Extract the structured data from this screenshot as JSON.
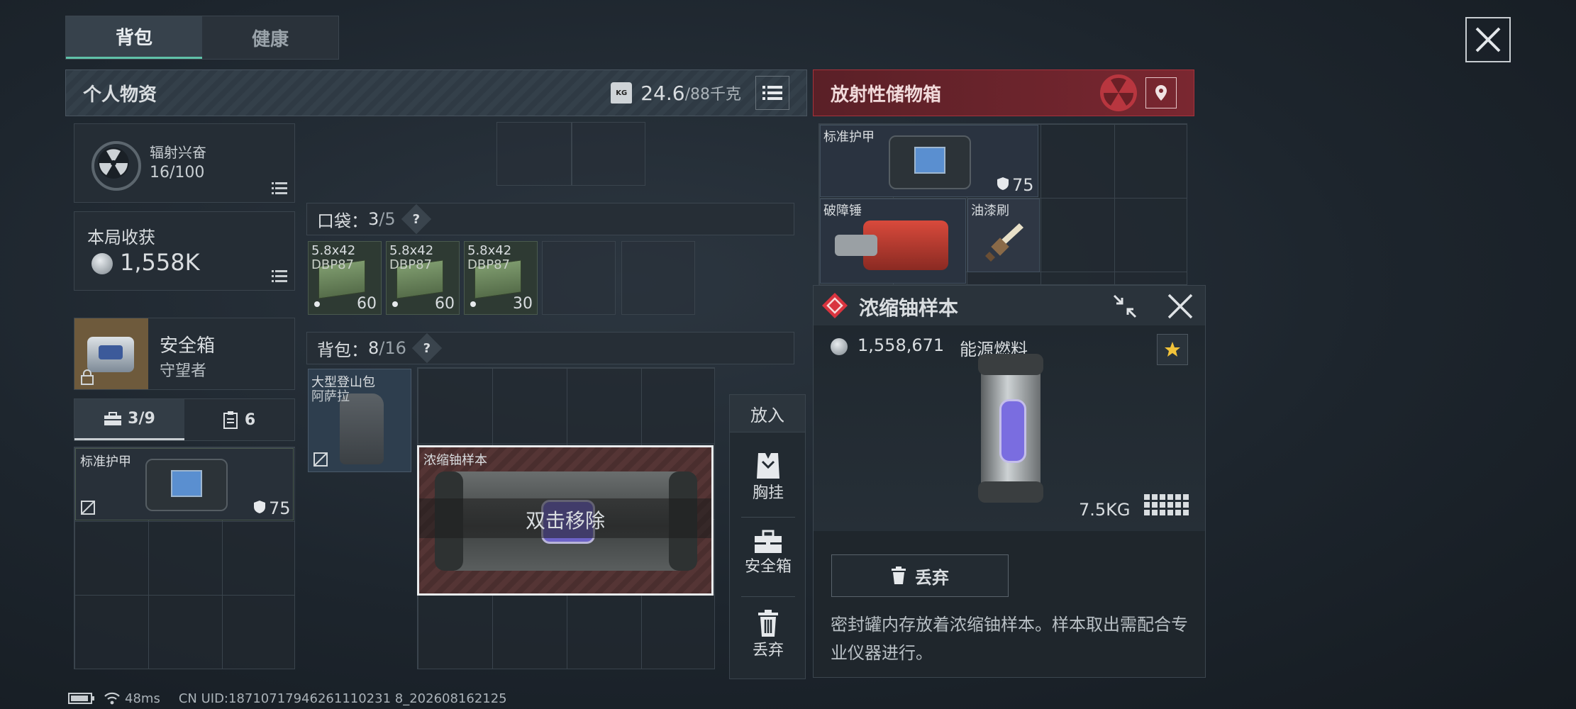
{
  "tabs": [
    "背包",
    "健康"
  ],
  "personal": {
    "title": "个人物资",
    "weight_current": "24.6",
    "weight_max": "/88千克",
    "kg_badge": "KG"
  },
  "radiation": {
    "label": "辐射兴奋",
    "value": "16/100",
    "level": 0.16
  },
  "income": {
    "label": "本局收获",
    "value": "1,558K"
  },
  "safe_box": {
    "name": "安全箱",
    "sub": "守望者"
  },
  "counters": {
    "tools": "3/9",
    "docs": "6"
  },
  "left_item": {
    "name": "标准护甲",
    "durability": "75"
  },
  "pocket": {
    "label": "口袋：",
    "used": "3",
    "total": "/5",
    "help": "?"
  },
  "ammo": [
    {
      "line1": "5.8x42",
      "line2": "DBP87",
      "count": "60"
    },
    {
      "line1": "5.8x42",
      "line2": "DBP87",
      "count": "60"
    },
    {
      "line1": "5.8x42",
      "line2": "DBP87",
      "count": "30"
    }
  ],
  "backpack": {
    "label": "背包：",
    "used": "8",
    "total": "/16",
    "help": "?"
  },
  "bag_item": {
    "line1": "大型登山包",
    "line2": "阿萨拉"
  },
  "uranium_slot": {
    "name": "浓缩铀样本",
    "action": "双击移除"
  },
  "drop_actions": {
    "title": "放入",
    "chest": "胸挂",
    "safe": "安全箱",
    "discard": "丢弃"
  },
  "radio_box": {
    "title": "放射性储物箱",
    "items": [
      {
        "name": "标准护甲",
        "value": "75"
      },
      {
        "name": "破障锤"
      },
      {
        "name": "油漆刷"
      }
    ]
  },
  "detail": {
    "title": "浓缩铀样本",
    "price": "1,558,671",
    "category": "能源燃料",
    "weight": "7.5KG",
    "discard": "丢弃",
    "description": "密封罐内存放着浓缩铀样本。样本取出需配合专业仪器进行。"
  },
  "status": {
    "ping": "48ms",
    "uid": "CN UID:18710717946261110231 8_202608162125"
  },
  "colors": {
    "accent": "#5fc1a8",
    "danger": "#a8323c",
    "rarity": "#d9343f"
  }
}
